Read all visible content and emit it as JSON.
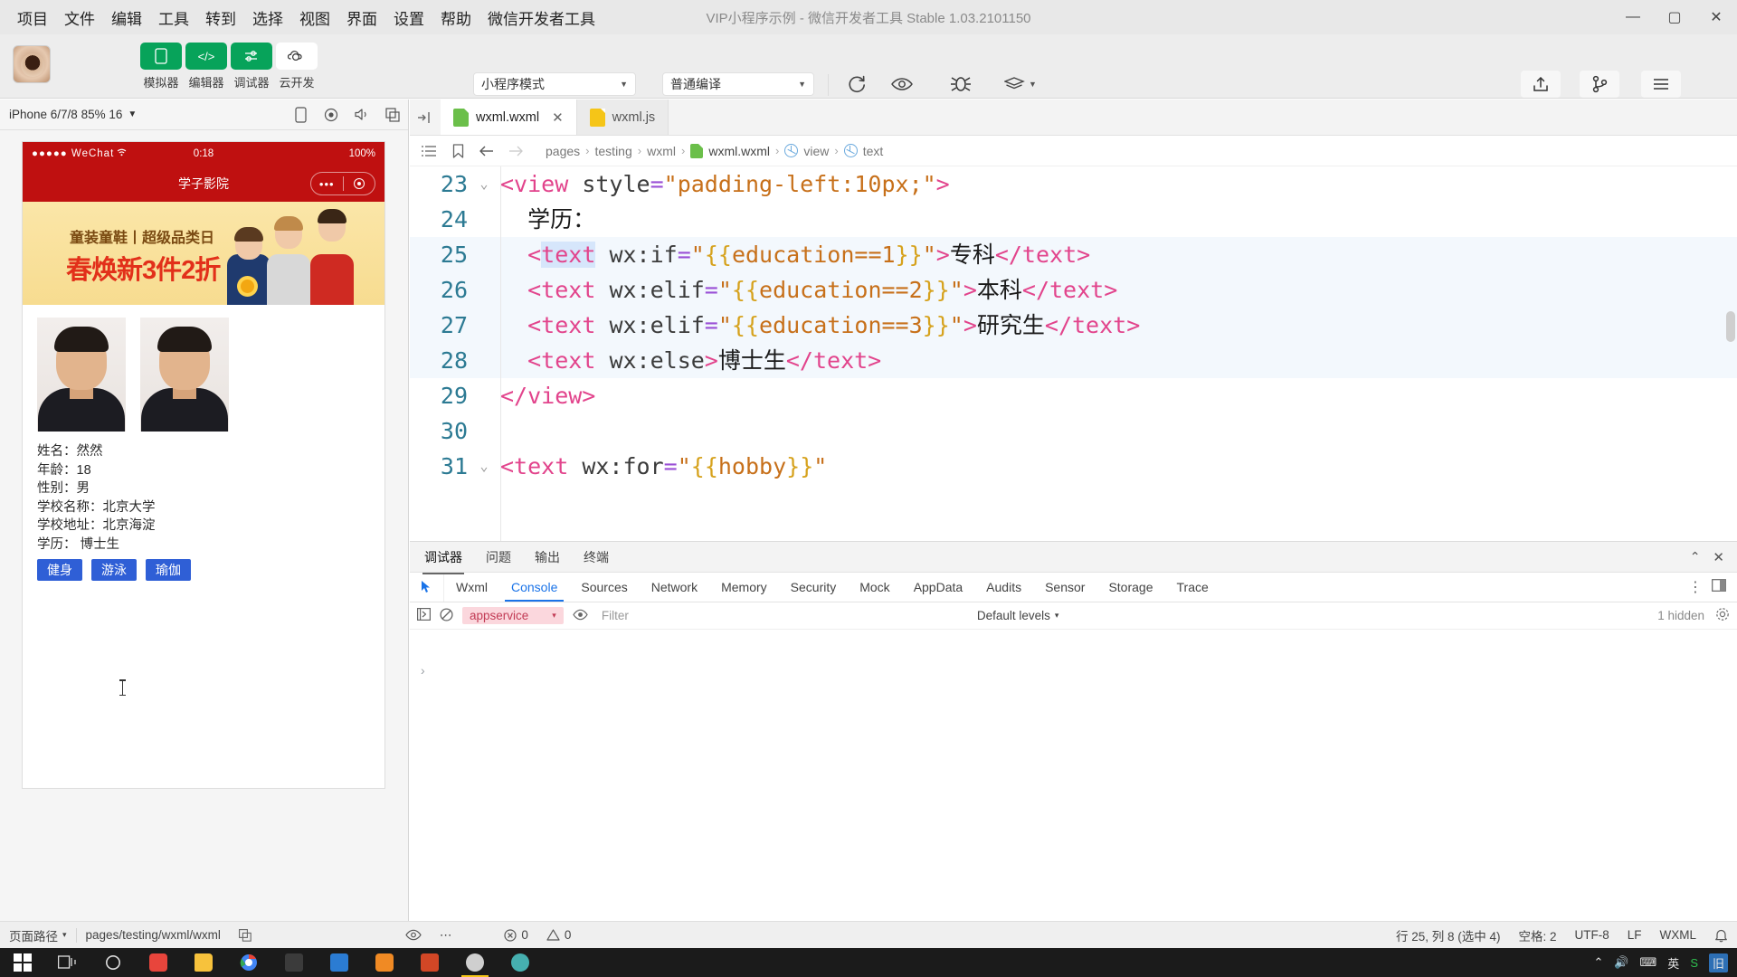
{
  "window": {
    "title": "VIP小程序示例 - 微信开发者工具 Stable 1.03.2101150",
    "minimize": "—",
    "maximize": "▢",
    "close": "✕"
  },
  "menubar": {
    "items": [
      "项目",
      "文件",
      "编辑",
      "工具",
      "转到",
      "选择",
      "视图",
      "界面",
      "设置",
      "帮助",
      "微信开发者工具"
    ]
  },
  "toolbar": {
    "mode_buttons": [
      {
        "label": "模拟器",
        "icon": "phone-icon"
      },
      {
        "label": "编辑器",
        "icon": "code-icon"
      },
      {
        "label": "调试器",
        "icon": "sliders-icon"
      },
      {
        "label": "云开发",
        "icon": "cloud-icon"
      }
    ],
    "mode_select": "小程序模式",
    "compile_select": "普通编译",
    "actions": [
      {
        "label": "编译",
        "icon": "refresh-icon"
      },
      {
        "label": "预览",
        "icon": "eye-icon"
      },
      {
        "label": "真机调试",
        "icon": "bug-icon"
      },
      {
        "label": "清缓存",
        "icon": "layers-icon"
      }
    ],
    "right_actions": [
      {
        "label": "上传",
        "icon": "upload-icon"
      },
      {
        "label": "版本管理",
        "icon": "branch-icon"
      },
      {
        "label": "详情",
        "icon": "menu-icon"
      }
    ]
  },
  "simulator": {
    "device_label": "iPhone 6/7/8 85% 16",
    "caret": "▾",
    "icons": [
      "phone-icon",
      "record-icon",
      "volume-icon",
      "copy-icon"
    ],
    "status": {
      "carrier": "●●●●● WeChat",
      "wifi": "⌃",
      "time": "0:18",
      "battery": "100%"
    },
    "nav_title": "学子影院",
    "capsule_dots": "•••",
    "banner": {
      "line1": "童装童鞋丨超级品类日",
      "line2": "春焕新3件2折"
    },
    "info_lines": [
      "姓名：然然",
      "年龄：18",
      "性别：男",
      "学校名称：北京大学",
      "学校地址：北京海淀",
      "学历： 博士生"
    ],
    "hobbies": [
      "健身",
      "游泳",
      "瑜伽"
    ]
  },
  "editor": {
    "tabs": [
      {
        "label": "wxml.wxml",
        "icon": "wxml-file-icon",
        "active": true,
        "close": "✕"
      },
      {
        "label": "wxml.js",
        "icon": "js-file-icon",
        "active": false,
        "close": ""
      }
    ],
    "breadcrumb": [
      "pages",
      "testing",
      "wxml",
      "wxml.wxml",
      "view",
      "text"
    ],
    "breadcrumb_separator": "›",
    "lines": [
      {
        "num": "23",
        "fold": "⌄",
        "highlight": false,
        "tokens": [
          {
            "t": "<view ",
            "c": "tk-tag"
          },
          {
            "t": "style",
            "c": "tk-attr"
          },
          {
            "t": "=",
            "c": "tk-eq"
          },
          {
            "t": "\"padding-left:10px;\"",
            "c": "tk-str"
          },
          {
            "t": ">",
            "c": "tk-tag"
          }
        ]
      },
      {
        "num": "24",
        "fold": "",
        "highlight": false,
        "tokens": [
          {
            "t": "  学历：",
            "c": "tk-txt"
          }
        ]
      },
      {
        "num": "25",
        "fold": "",
        "highlight": true,
        "tokens": [
          {
            "t": "  ",
            "c": "tk-txt"
          },
          {
            "t": "<",
            "c": "tk-angle"
          },
          {
            "t": "text",
            "c": "tk-tag-s"
          },
          {
            "t": " ",
            "c": "tk-attr"
          },
          {
            "t": "wx:if",
            "c": "tk-attr"
          },
          {
            "t": "=",
            "c": "tk-eq"
          },
          {
            "t": "\"",
            "c": "tk-str"
          },
          {
            "t": "{{",
            "c": "tk-brace"
          },
          {
            "t": "education==1",
            "c": "tk-expr"
          },
          {
            "t": "}}",
            "c": "tk-brace"
          },
          {
            "t": "\"",
            "c": "tk-str"
          },
          {
            "t": ">",
            "c": "tk-angle"
          },
          {
            "t": "专科",
            "c": "tk-txt"
          },
          {
            "t": "</text>",
            "c": "tk-tag"
          }
        ]
      },
      {
        "num": "26",
        "fold": "",
        "highlight": true,
        "tokens": [
          {
            "t": "  ",
            "c": "tk-txt"
          },
          {
            "t": "<text",
            "c": "tk-tag"
          },
          {
            "t": " ",
            "c": "tk-attr"
          },
          {
            "t": "wx:elif",
            "c": "tk-attr"
          },
          {
            "t": "=",
            "c": "tk-eq"
          },
          {
            "t": "\"",
            "c": "tk-str"
          },
          {
            "t": "{{",
            "c": "tk-brace"
          },
          {
            "t": "education==2",
            "c": "tk-expr"
          },
          {
            "t": "}}",
            "c": "tk-brace"
          },
          {
            "t": "\"",
            "c": "tk-str"
          },
          {
            "t": ">",
            "c": "tk-angle"
          },
          {
            "t": "本科",
            "c": "tk-txt"
          },
          {
            "t": "</text>",
            "c": "tk-tag"
          }
        ]
      },
      {
        "num": "27",
        "fold": "",
        "highlight": true,
        "tokens": [
          {
            "t": "  ",
            "c": "tk-txt"
          },
          {
            "t": "<text",
            "c": "tk-tag"
          },
          {
            "t": " ",
            "c": "tk-attr"
          },
          {
            "t": "wx:elif",
            "c": "tk-attr"
          },
          {
            "t": "=",
            "c": "tk-eq"
          },
          {
            "t": "\"",
            "c": "tk-str"
          },
          {
            "t": "{{",
            "c": "tk-brace"
          },
          {
            "t": "education==3",
            "c": "tk-expr"
          },
          {
            "t": "}}",
            "c": "tk-brace"
          },
          {
            "t": "\"",
            "c": "tk-str"
          },
          {
            "t": ">",
            "c": "tk-angle"
          },
          {
            "t": "研究生",
            "c": "tk-txt"
          },
          {
            "t": "</text>",
            "c": "tk-tag"
          }
        ]
      },
      {
        "num": "28",
        "fold": "",
        "highlight": true,
        "tokens": [
          {
            "t": "  ",
            "c": "tk-txt"
          },
          {
            "t": "<text",
            "c": "tk-tag"
          },
          {
            "t": " ",
            "c": "tk-attr"
          },
          {
            "t": "wx:else",
            "c": "tk-attr"
          },
          {
            "t": ">",
            "c": "tk-angle"
          },
          {
            "t": "博士生",
            "c": "tk-txt"
          },
          {
            "t": "</text>",
            "c": "tk-tag"
          }
        ]
      },
      {
        "num": "29",
        "fold": "",
        "highlight": false,
        "tokens": [
          {
            "t": "</view>",
            "c": "tk-tag"
          }
        ]
      },
      {
        "num": "30",
        "fold": "",
        "highlight": false,
        "tokens": [
          {
            "t": "",
            "c": "tk-txt"
          }
        ]
      },
      {
        "num": "31",
        "fold": "⌄",
        "highlight": false,
        "tokens": [
          {
            "t": "<text",
            "c": "tk-tag"
          },
          {
            "t": " ",
            "c": "tk-attr"
          },
          {
            "t": "wx:for",
            "c": "tk-attr"
          },
          {
            "t": "=",
            "c": "tk-eq"
          },
          {
            "t": "\"",
            "c": "tk-str"
          },
          {
            "t": "{{",
            "c": "tk-brace"
          },
          {
            "t": "hobby",
            "c": "tk-expr"
          },
          {
            "t": "}}",
            "c": "tk-brace"
          },
          {
            "t": "\"",
            "c": "tk-str"
          }
        ]
      }
    ]
  },
  "devtools": {
    "panel_tabs": [
      "调试器",
      "问题",
      "输出",
      "终端"
    ],
    "panel_active": "调试器",
    "collapse_icon": "⌃",
    "close_icon": "✕",
    "tabs": [
      "Wxml",
      "Console",
      "Sources",
      "Network",
      "Memory",
      "Security",
      "Mock",
      "AppData",
      "Audits",
      "Sensor",
      "Storage",
      "Trace"
    ],
    "active_tab": "Console",
    "more_icon": "⋮",
    "dock_icon": "▣",
    "context": "appservice",
    "context_caret": "▾",
    "filter_placeholder": "Filter",
    "levels": "Default levels",
    "levels_caret": "▾",
    "hidden_count": "1 hidden",
    "settings_icon": "gear-icon",
    "prompt": "›"
  },
  "statusbar": {
    "page_path_label": "页面路径",
    "page_path_caret": "▾",
    "page_path": "pages/testing/wxml/wxml",
    "copy_icon": "copy-icon",
    "eye_icon": "eye-icon",
    "more_icon": "⋯",
    "errors": "0",
    "warnings": "0",
    "cursor": "行 25, 列 8 (选中 4)",
    "spaces": "空格: 2",
    "encoding": "UTF-8",
    "eol": "LF",
    "language": "WXML",
    "bell_icon": "bell-icon"
  },
  "taskbar": {
    "items": [
      {
        "name": "start-button",
        "color": "#2d8cf0"
      },
      {
        "name": "task-view",
        "color": "#cccccc"
      },
      {
        "name": "cortana",
        "color": "#dddddd"
      },
      {
        "name": "app-c",
        "color": "#e8453c"
      },
      {
        "name": "file-explorer",
        "color": "#f7c23c"
      },
      {
        "name": "chrome",
        "color": "#4285f4"
      },
      {
        "name": "typora",
        "color": "#444444"
      },
      {
        "name": "vscode",
        "color": "#2b7cd3"
      },
      {
        "name": "app-orange",
        "color": "#f08a24"
      },
      {
        "name": "powerpoint",
        "color": "#d24726"
      },
      {
        "name": "wechat-devtools",
        "color": "#cfcfcf"
      },
      {
        "name": "app-teal",
        "color": "#46b0b0"
      }
    ],
    "tray": [
      "⌃",
      "🔊",
      "⌨",
      "英",
      "S",
      "旧"
    ]
  },
  "colors": {
    "accent_green": "#07a35a",
    "accent_blue": "#1a73e8",
    "wechat_red": "#bf1010",
    "hobby_blue": "#2f5fd6"
  }
}
